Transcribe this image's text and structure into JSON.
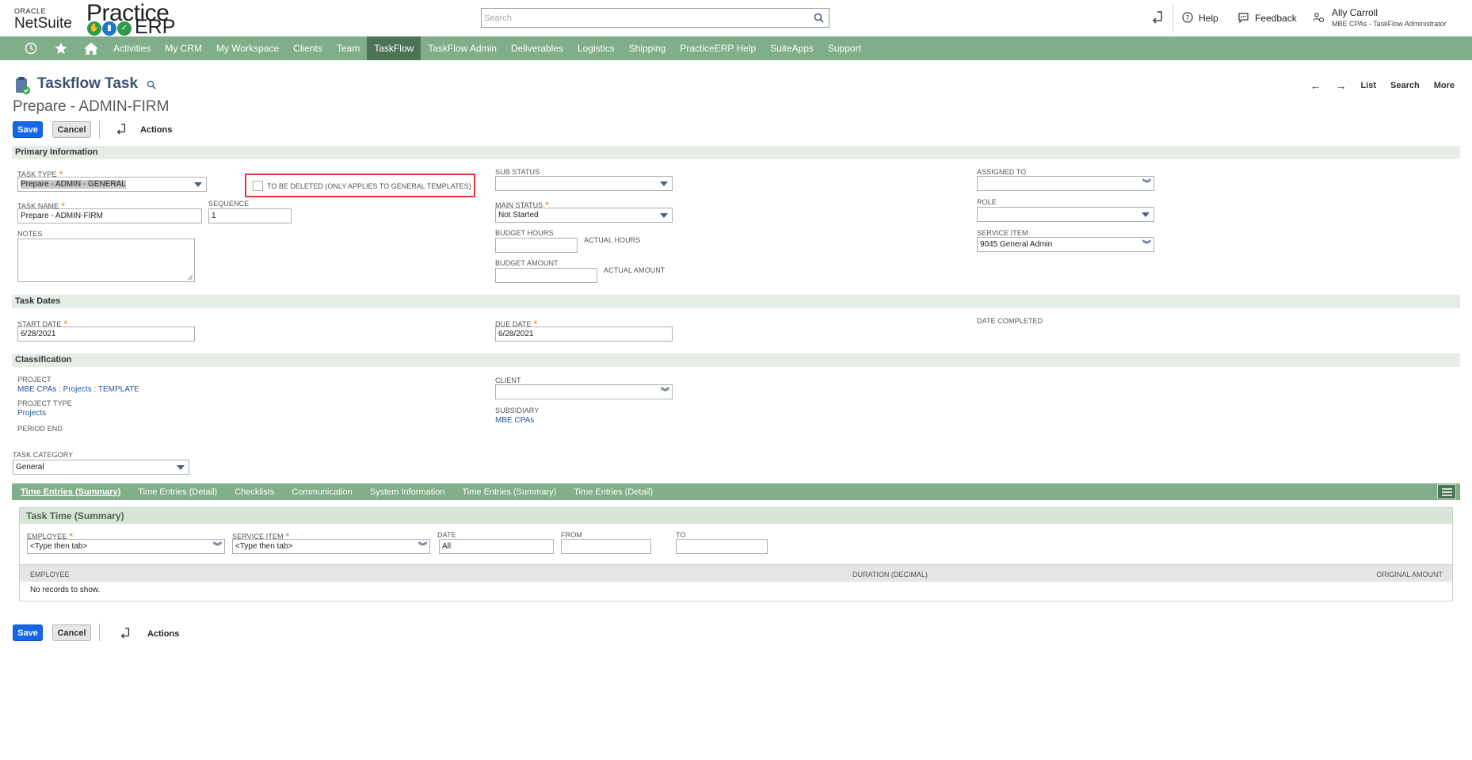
{
  "header": {
    "oracle_label": "ORACLE",
    "netsuite_label": "NetSuite",
    "practice_label": "Practice",
    "erp_label": "ERP",
    "search_placeholder": "Search",
    "help_label": "Help",
    "feedback_label": "Feedback",
    "user_name": "Ally Carroll",
    "user_role": "MBE CPAs - TaskFlow Administrator"
  },
  "nav": {
    "items": [
      "Activities",
      "My CRM",
      "My Workspace",
      "Clients",
      "Team",
      "TaskFlow",
      "TaskFlow Admin",
      "Deliverables",
      "Logistics",
      "Shipping",
      "PracticeERP Help",
      "SuiteApps",
      "Support"
    ],
    "active": "TaskFlow"
  },
  "page": {
    "title": "Taskflow Task",
    "record_name": "Prepare - ADMIN-FIRM",
    "pager": {
      "list": "List",
      "search": "Search",
      "more": "More"
    }
  },
  "toolbar": {
    "save_label": "Save",
    "cancel_label": "Cancel",
    "actions_label": "Actions"
  },
  "primary": {
    "heading": "Primary Information",
    "task_type_label": "TASK TYPE",
    "task_type_value": "Prepare - ADMIN - GENERAL",
    "to_be_deleted_label": "TO BE DELETED (ONLY APPLIES TO GENERAL TEMPLATES)",
    "task_name_label": "TASK NAME",
    "task_name_value": "Prepare - ADMIN-FIRM",
    "sequence_label": "SEQUENCE",
    "sequence_value": "1",
    "notes_label": "NOTES",
    "sub_status_label": "SUB STATUS",
    "main_status_label": "MAIN STATUS",
    "main_status_value": "Not Started",
    "budget_hours_label": "BUDGET HOURS",
    "actual_hours_label": "ACTUAL HOURS",
    "budget_amount_label": "BUDGET AMOUNT",
    "actual_amount_label": "ACTUAL AMOUNT",
    "assigned_to_label": "ASSIGNED TO",
    "role_label": "ROLE",
    "service_item_label": "SERVICE ITEM",
    "service_item_value": "9045 General Admin"
  },
  "dates": {
    "heading": "Task Dates",
    "start_label": "START DATE",
    "start_value": "6/28/2021",
    "due_label": "DUE DATE",
    "due_value": "6/28/2021",
    "completed_label": "DATE COMPLETED"
  },
  "classification": {
    "heading": "Classification",
    "project_label": "PROJECT",
    "project_value": "MBE CPAs : Projects : TEMPLATE",
    "project_type_label": "PROJECT TYPE",
    "project_type_value": "Projects",
    "period_end_label": "PERIOD END",
    "client_label": "CLIENT",
    "subsidiary_label": "SUBSIDIARY",
    "subsidiary_value": "MBE CPAs",
    "task_category_label": "TASK CATEGORY",
    "task_category_value": "General"
  },
  "subtabs": [
    "Time Entries (Summary)",
    "Time Entries (Detail)",
    "Checklists",
    "Communication",
    "System Information",
    "Time Entries (Summary)",
    "Time Entries (Detail)"
  ],
  "time_panel": {
    "tab_label": "Task Time (Summary)",
    "employee_label": "EMPLOYEE",
    "employee_placeholder": "<Type then tab>",
    "service_item_label": "SERVICE ITEM",
    "service_item_placeholder": "<Type then tab>",
    "date_label": "DATE",
    "date_value": "All",
    "from_label": "FROM",
    "to_label": "TO",
    "columns": [
      "EMPLOYEE",
      "DURATION (DECIMAL)",
      "ORIGINAL AMOUNT"
    ],
    "empty_text": "No records to show."
  },
  "colors": {
    "nav_bg": "#7fae88",
    "nav_active": "#4d7355",
    "save_blue": "#1467e8",
    "title_color": "#3d5171",
    "required": "#e87722",
    "highlight_red": "#e23636"
  }
}
